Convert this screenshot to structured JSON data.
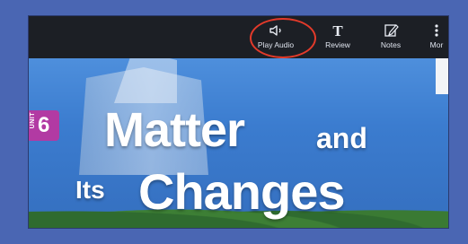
{
  "toolbar": {
    "play_audio_label": "Play Audio",
    "review_label": "Review",
    "notes_label": "Notes",
    "more_label": "Mor",
    "highlight_color": "#e33a2a"
  },
  "cover": {
    "unit_word": "UNIT",
    "unit_number": "6",
    "title_line1": "Matter",
    "title_and": "and",
    "title_its": "Its",
    "title_line2": "Changes"
  },
  "icons": {
    "play_audio": "speaker-icon",
    "review": "text-T-icon",
    "notes": "notes-pencil-icon",
    "more": "vertical-dots-icon"
  }
}
